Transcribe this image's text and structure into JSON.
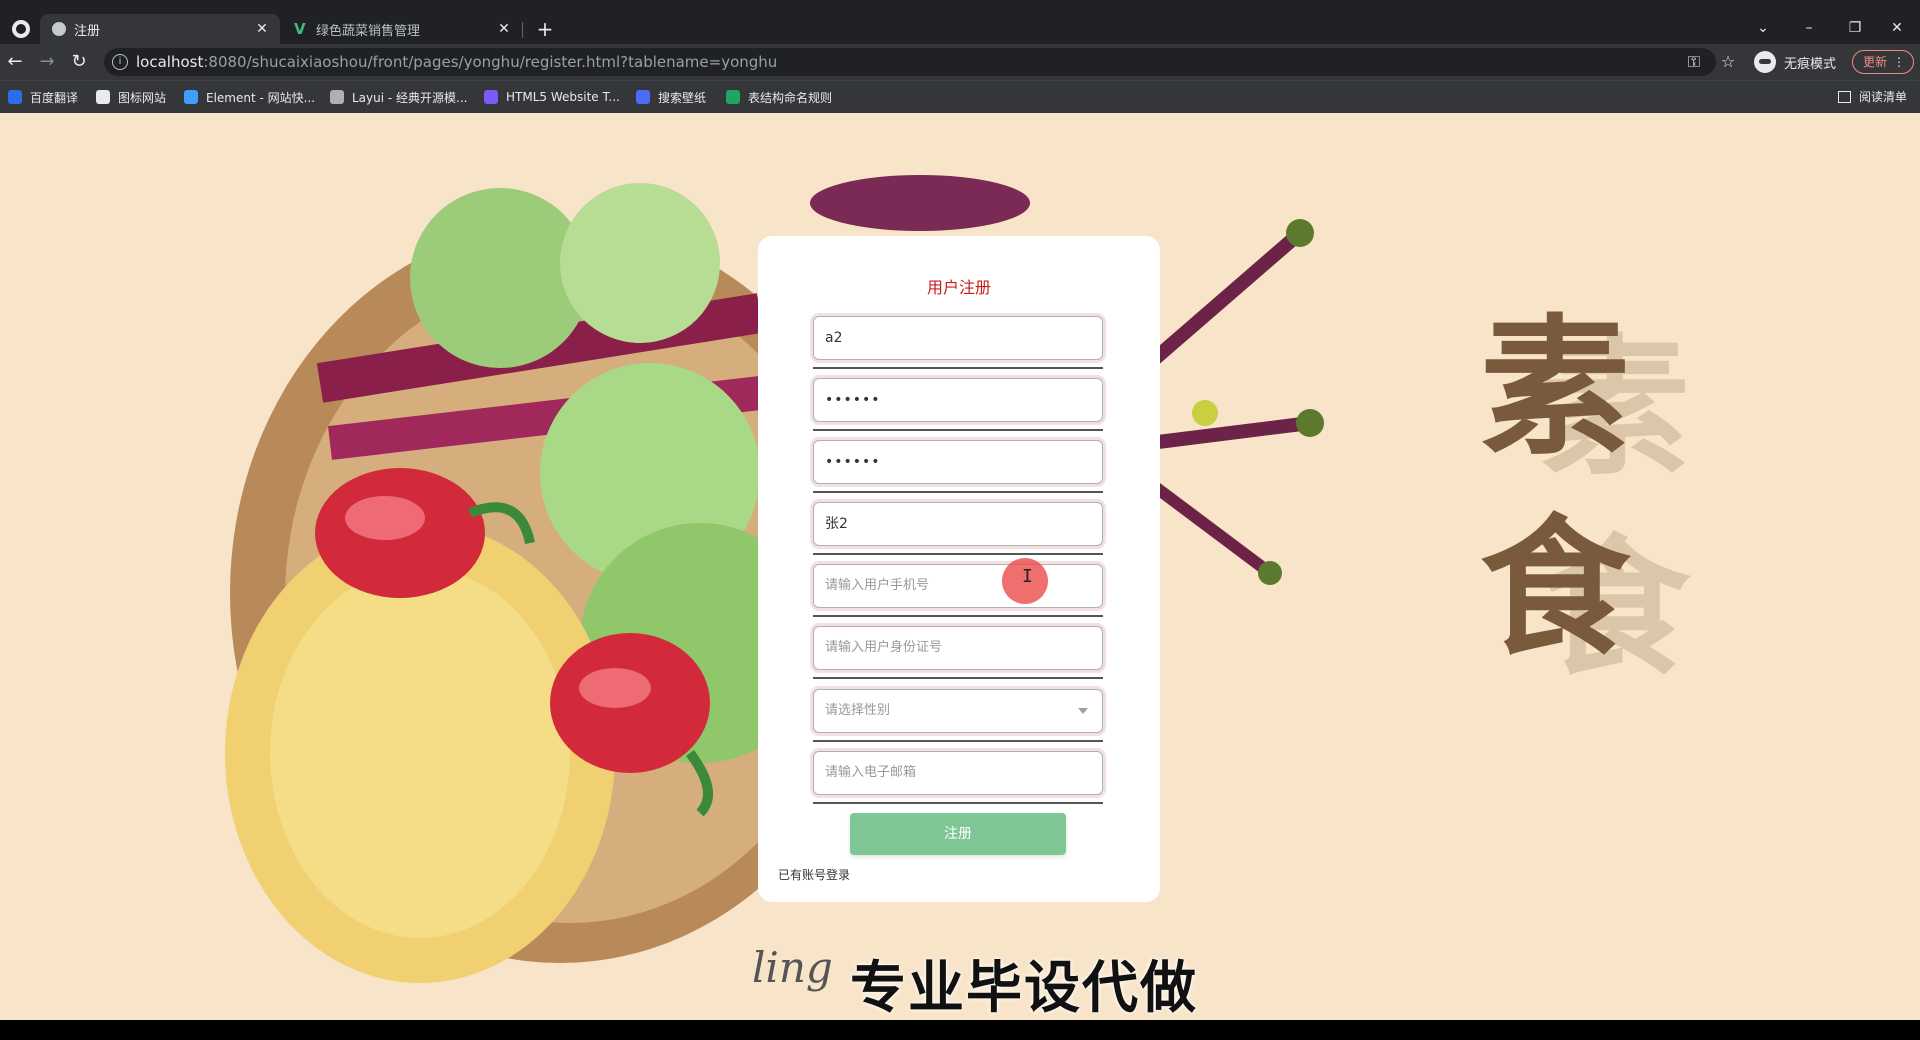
{
  "browser": {
    "tabs": [
      {
        "title": "注册",
        "active": true
      },
      {
        "title": "绿色蔬菜销售管理",
        "active": false
      }
    ],
    "url_host": "localhost",
    "url_rest": ":8080/shucaixiaoshou/front/pages/yonghu/register.html?tablename=yonghu",
    "profile_label": "无痕模式",
    "update_label": "更新",
    "bookmarks": [
      {
        "label": "百度翻译",
        "color": "#2b6de8"
      },
      {
        "label": "图标网站",
        "color": "#e8eaed"
      },
      {
        "label": "Element - 网站快...",
        "color": "#409eff"
      },
      {
        "label": "Layui - 经典开源模...",
        "color": "#b0b0b0"
      },
      {
        "label": "HTML5 Website T...",
        "color": "#7a5af8"
      },
      {
        "label": "搜索壁纸",
        "color": "#4a6cf7"
      },
      {
        "label": "表结构命名规则",
        "color": "#1fa463"
      }
    ],
    "reading_list": "阅读清单"
  },
  "form": {
    "title": "用户注册",
    "fields": [
      {
        "value": "a2",
        "placeholder": ""
      },
      {
        "value": "••••••",
        "placeholder": ""
      },
      {
        "value": "••••••",
        "placeholder": ""
      },
      {
        "value": "张2",
        "placeholder": ""
      },
      {
        "value": "",
        "placeholder": "请输入用户手机号"
      },
      {
        "value": "",
        "placeholder": "请输入用户身份证号"
      },
      {
        "value": "",
        "placeholder": "请选择性别"
      },
      {
        "value": "",
        "placeholder": "请输入电子邮箱"
      }
    ],
    "submit_label": "注册",
    "login_link": "已有账号登录"
  },
  "decor": {
    "calligraphy_1": "素",
    "calligraphy_2": "食",
    "watermark": "专业毕设代做",
    "signature": "ling"
  }
}
